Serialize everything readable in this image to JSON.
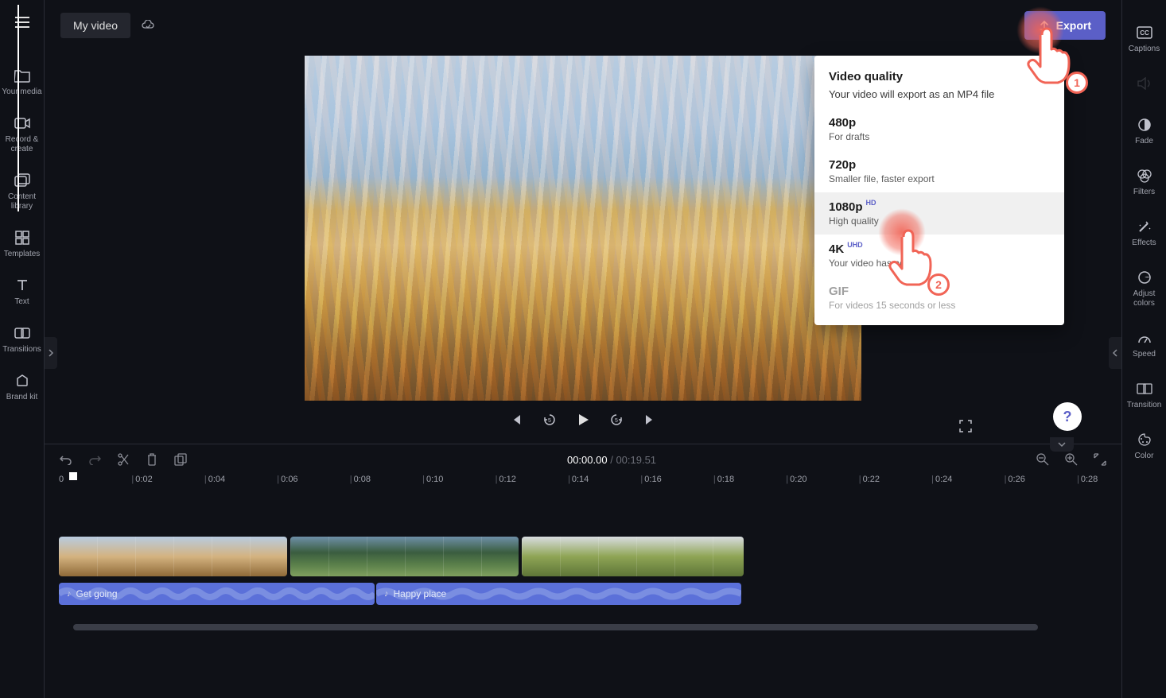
{
  "title": "My video",
  "sidebar_left": [
    {
      "label": "Your media",
      "icon": "folder-icon"
    },
    {
      "label": "Record & create",
      "icon": "camera-icon"
    },
    {
      "label": "Content library",
      "icon": "library-icon"
    },
    {
      "label": "Templates",
      "icon": "templates-icon"
    },
    {
      "label": "Text",
      "icon": "text-icon"
    },
    {
      "label": "Transitions",
      "icon": "transitions-icon"
    },
    {
      "label": "Brand kit",
      "icon": "brandkit-icon"
    }
  ],
  "sidebar_right": [
    {
      "label": "Captions",
      "icon": "captions-icon"
    },
    {
      "label": "",
      "icon": "audio-icon"
    },
    {
      "label": "Fade",
      "icon": "fade-icon"
    },
    {
      "label": "Filters",
      "icon": "filters-icon"
    },
    {
      "label": "Effects",
      "icon": "effects-icon"
    },
    {
      "label": "Adjust colors",
      "icon": "adjust-icon"
    },
    {
      "label": "Speed",
      "icon": "speed-icon"
    },
    {
      "label": "Transition",
      "icon": "transition-icon"
    },
    {
      "label": "Color",
      "icon": "color-icon"
    }
  ],
  "export": {
    "button_label": "Export",
    "popup": {
      "title": "Video quality",
      "description": "Your video will export as an MP4 file",
      "options": [
        {
          "title": "480p",
          "sub": "For drafts",
          "badge": ""
        },
        {
          "title": "720p",
          "sub": "Smaller file, faster export",
          "badge": ""
        },
        {
          "title": "1080p",
          "sub": "High quality",
          "badge": "HD"
        },
        {
          "title": "4K",
          "sub": "Your video has no 4...",
          "badge": "UHD"
        },
        {
          "title": "GIF",
          "sub": "For videos 15 seconds or less",
          "badge": ""
        }
      ]
    }
  },
  "timecode": {
    "current": "00:00.00",
    "total": "00:19.51"
  },
  "ruler_ticks": [
    "0",
    "0:02",
    "0:04",
    "0:06",
    "0:08",
    "0:10",
    "0:12",
    "0:14",
    "0:16",
    "0:18",
    "0:20",
    "0:22",
    "0:24",
    "0:26",
    "0:28"
  ],
  "audio_clips": [
    {
      "name": "Get going"
    },
    {
      "name": "Happy place"
    }
  ],
  "pointers": [
    {
      "num": "1"
    },
    {
      "num": "2"
    }
  ],
  "help_label": "?"
}
